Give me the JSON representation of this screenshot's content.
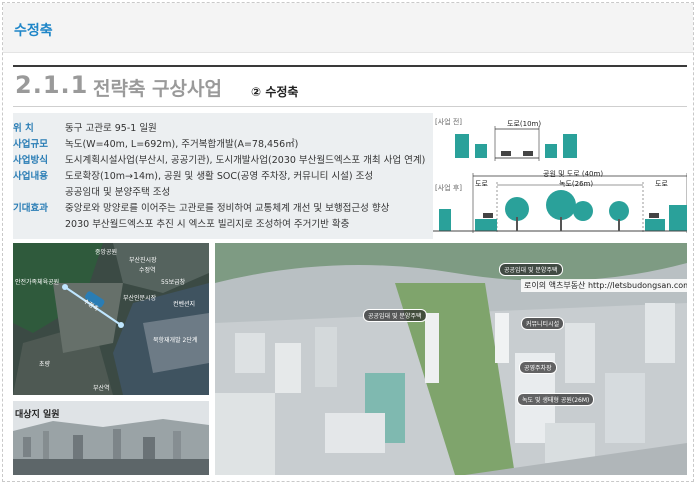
{
  "header": {
    "title": "수정축"
  },
  "section": {
    "number": "2.1.1",
    "title": "전략축 구상사업",
    "subtitle": "② 수정축"
  },
  "info": [
    {
      "label": "위    치",
      "value": "동구 고관로 95-1 일원"
    },
    {
      "label": "사업규모",
      "value": "녹도(W=40m, L=692m), 주거복합개발(A=78,456㎡)"
    },
    {
      "label": "사업방식",
      "value": "도시계획시설사업(부산시, 공공기관), 도시개발사업(2030 부산월드엑스포 개최 사업 연계)"
    },
    {
      "label": "사업내용",
      "value": "도로확장(10m→14m), 공원 및 생활 SOC(공영 주차장, 커뮤니티 시설) 조성"
    },
    {
      "label": "",
      "value": "공공임대 및 분양주택 조성"
    },
    {
      "label": "기대효과",
      "value": "중앙로와 망양로를 이어주는 고관로를 정비하여 교통체계 개선 및 보행접근성 향상"
    },
    {
      "label": "",
      "value": "2030 부산월드엑스포 추진 시 엑스포 빌리지로 조성하여 주거기반 확충"
    }
  ],
  "section_diagram": {
    "before_tag": "[사업 전]",
    "after_tag": "[사업 후]",
    "road_before": "도로(10m)",
    "park_and_road": "공원 및 도로 (40m)",
    "road_left": "도로",
    "green_road": "녹도(26m)",
    "road_right": "도로"
  },
  "map": {
    "labels": [
      "중앙공원",
      "부산진시장",
      "55보급창",
      "수정역",
      "안전가족체육공원",
      "부산인문시장",
      "컨벤션지",
      "북항재개발 2단계",
      "초량",
      "부산역"
    ],
    "axis_label": "수정축"
  },
  "photo_caption": "대상지 일원",
  "rendering": {
    "watermark": "로이의 액츠부동산 http://letsbudongsan.com",
    "labels": [
      "공공임대 및 분양주택",
      "공공임대 및 분양주택",
      "커뮤니티시설",
      "공영주차장",
      "녹도 및 생태형 공원(26M)"
    ]
  },
  "colors": {
    "accent": "#1f86c8",
    "label_blue": "#2a7db5",
    "infobox_bg": "#eceff1",
    "heading_gray": "#9a9a9a"
  }
}
